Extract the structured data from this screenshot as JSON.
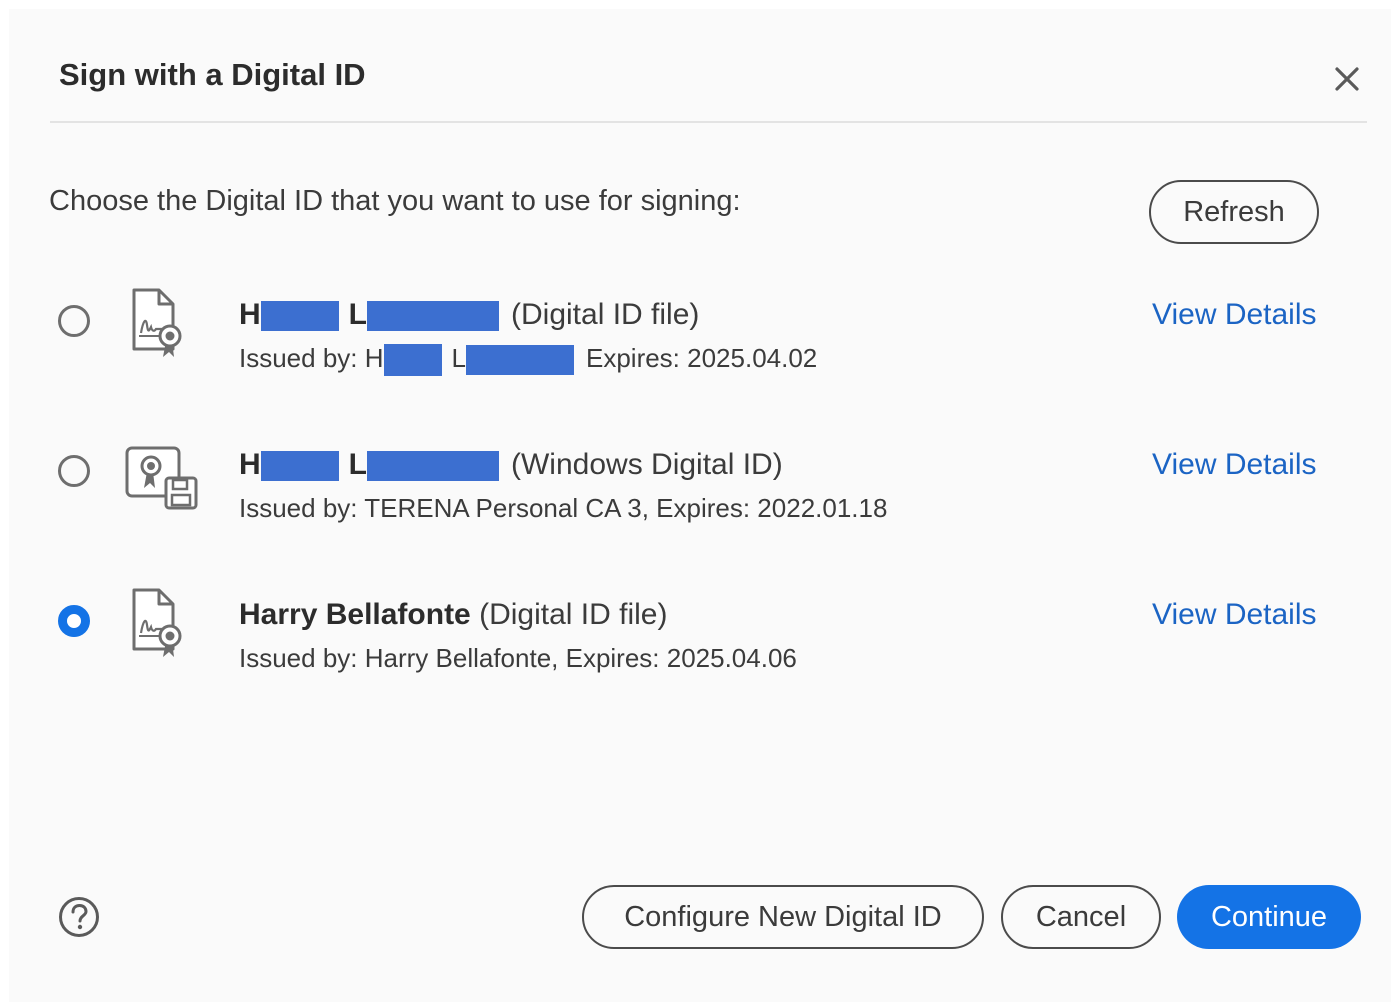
{
  "dialog": {
    "title": "Sign with a Digital ID",
    "prompt": "Choose the Digital ID that you want to use for signing:",
    "refresh_label": "Refresh"
  },
  "ids": [
    {
      "name_first_initial": "H",
      "name_last_initial": "L",
      "type": "(Digital ID file)",
      "issued_prefix": "Issued by: H",
      "issued_mid": "L",
      "expires": "Expires: 2025.04.02",
      "view_details": "View Details",
      "selected": false,
      "icon": "digital-id-file-icon"
    },
    {
      "name_first_initial": "H",
      "name_last_initial": "L",
      "type": "(Windows Digital ID)",
      "issued_text": "Issued by: TERENA Personal CA 3, Expires: 2022.01.18",
      "view_details": "View Details",
      "selected": false,
      "icon": "windows-digital-id-icon"
    },
    {
      "name": "Harry Bellafonte",
      "type": "(Digital ID file)",
      "issued_text": "Issued by: Harry Bellafonte, Expires: 2025.04.06",
      "view_details": "View Details",
      "selected": true,
      "icon": "digital-id-file-icon"
    }
  ],
  "footer": {
    "configure_label": "Configure New Digital ID",
    "cancel_label": "Cancel",
    "continue_label": "Continue"
  },
  "colors": {
    "accent": "#1473e6",
    "link": "#1b64c4",
    "redaction": "#3c6fd0"
  }
}
